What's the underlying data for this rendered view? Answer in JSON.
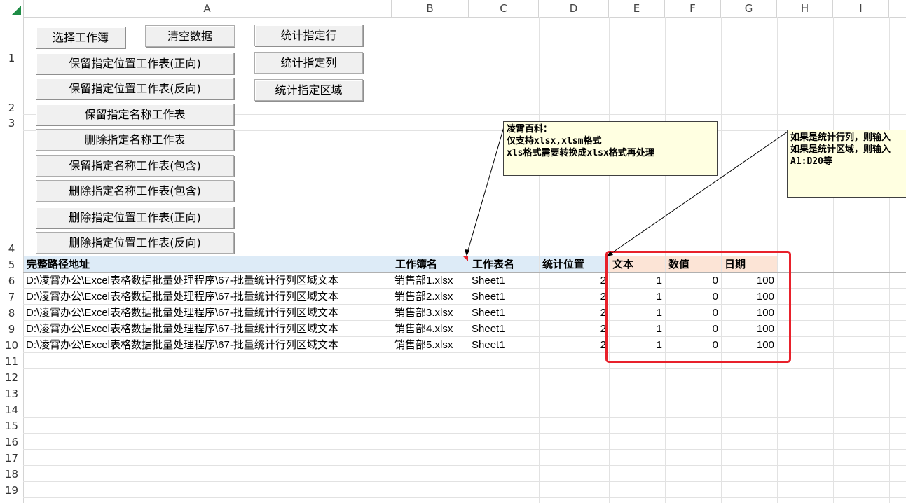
{
  "columns": [
    "A",
    "B",
    "C",
    "D",
    "E",
    "F",
    "G",
    "H",
    "I"
  ],
  "rows": [
    "1",
    "2",
    "3",
    "4",
    "5",
    "6",
    "7",
    "8",
    "9",
    "10",
    "11",
    "12",
    "13",
    "14",
    "15",
    "16",
    "17",
    "18",
    "19"
  ],
  "buttons": {
    "select_workbook": "选择工作簿",
    "clear_data": "清空数据",
    "count_row": "统计指定行",
    "count_col": "统计指定列",
    "count_range": "统计指定区域",
    "keep_pos_fwd": "保留指定位置工作表(正向)",
    "keep_pos_rev": "保留指定位置工作表(反向)",
    "keep_name": "保留指定名称工作表",
    "del_name": "删除指定名称工作表",
    "keep_name_contains": "保留指定名称工作表(包含)",
    "del_name_contains": "删除指定名称工作表(包含)",
    "del_pos_fwd": "删除指定位置工作表(正向)",
    "del_pos_rev": "删除指定位置工作表(反向)"
  },
  "headers": {
    "path": "完整路径地址",
    "workbook": "工作簿名",
    "sheet": "工作表名",
    "position": "统计位置",
    "text": "文本",
    "number": "数值",
    "date": "日期"
  },
  "table": [
    {
      "path": "D:\\凌霄办公\\Excel表格数据批量处理程序\\67-批量统计行列区域文本",
      "workbook": "销售部1.xlsx",
      "sheet": "Sheet1",
      "position": "2",
      "text": "1",
      "number": "0",
      "date": "100"
    },
    {
      "path": "D:\\凌霄办公\\Excel表格数据批量处理程序\\67-批量统计行列区域文本",
      "workbook": "销售部2.xlsx",
      "sheet": "Sheet1",
      "position": "2",
      "text": "1",
      "number": "0",
      "date": "100"
    },
    {
      "path": "D:\\凌霄办公\\Excel表格数据批量处理程序\\67-批量统计行列区域文本",
      "workbook": "销售部3.xlsx",
      "sheet": "Sheet1",
      "position": "2",
      "text": "1",
      "number": "0",
      "date": "100"
    },
    {
      "path": "D:\\凌霄办公\\Excel表格数据批量处理程序\\67-批量统计行列区域文本",
      "workbook": "销售部4.xlsx",
      "sheet": "Sheet1",
      "position": "2",
      "text": "1",
      "number": "0",
      "date": "100"
    },
    {
      "path": "D:\\凌霄办公\\Excel表格数据批量处理程序\\67-批量统计行列区域文本",
      "workbook": "销售部5.xlsx",
      "sheet": "Sheet1",
      "position": "2",
      "text": "1",
      "number": "0",
      "date": "100"
    }
  ],
  "comments": {
    "note1": "凌霄百科：\n仅支持xlsx,xlsm格式\nxls格式需要转换成xlsx格式再处理",
    "note2": "如果是统计行列，则输入\n如果是统计区域，则输入\nA1:D20等"
  },
  "colors": {
    "header_blue": "#ddebf7",
    "header_peach": "#fce4d6",
    "highlight_red": "#e8212b",
    "comment_bg": "#ffffe1",
    "excel_green": "#1e8c45"
  }
}
